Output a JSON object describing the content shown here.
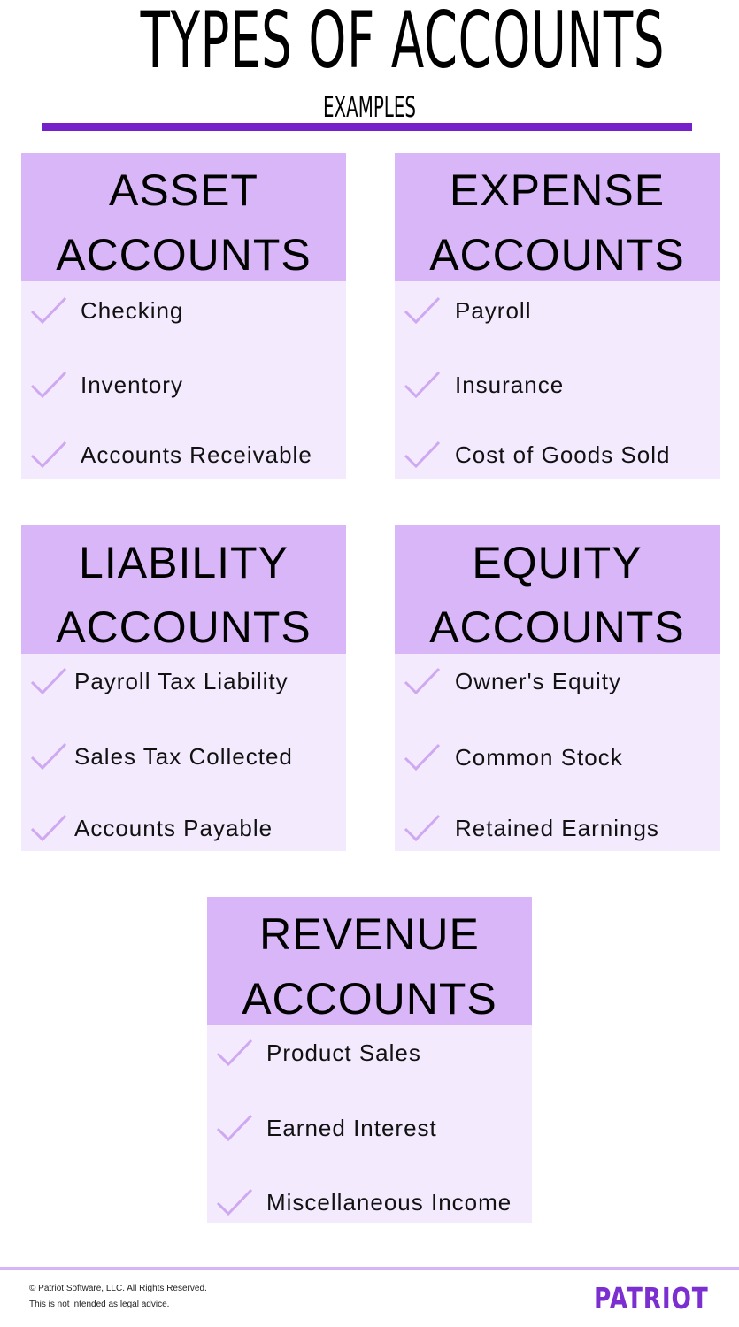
{
  "header": {
    "title": "TYPES OF ACCOUNTS",
    "subtitle": "EXAMPLES"
  },
  "colors": {
    "accent": "#7520c8",
    "card_header": "#d9b6f7",
    "card_body": "#f4eafe",
    "check": "#cfa8f2",
    "logo": "#7b2fd0"
  },
  "cards": [
    {
      "title_line1": "ASSET",
      "title_line2": "ACCOUNTS",
      "items": [
        "Checking",
        "Inventory",
        "Accounts Receivable"
      ]
    },
    {
      "title_line1": "EXPENSE",
      "title_line2": "ACCOUNTS",
      "items": [
        "Payroll",
        "Insurance",
        "Cost of Goods Sold"
      ]
    },
    {
      "title_line1": "LIABILITY",
      "title_line2": "ACCOUNTS",
      "items": [
        "Payroll Tax Liability",
        "Sales Tax Collected",
        "Accounts Payable"
      ]
    },
    {
      "title_line1": "EQUITY",
      "title_line2": "ACCOUNTS",
      "items": [
        "Owner's Equity",
        "Common Stock",
        "Retained Earnings"
      ]
    },
    {
      "title_line1": "REVENUE",
      "title_line2": "ACCOUNTS",
      "items": [
        "Product Sales",
        "Earned Interest",
        "Miscellaneous Income"
      ]
    }
  ],
  "icons": {
    "item_marker": "checkmark-icon"
  },
  "footer": {
    "copyright": "© Patriot Software, LLC. All Rights Reserved.",
    "disclaimer": "This is not intended as legal advice.",
    "logo": "PATRIOT"
  }
}
